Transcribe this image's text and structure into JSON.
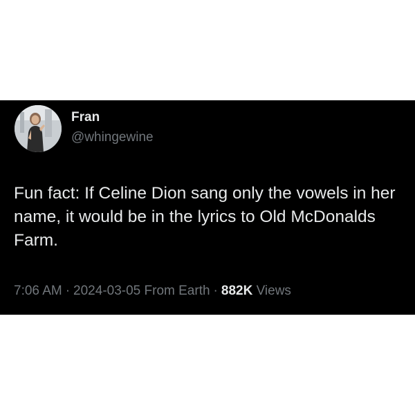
{
  "tweet": {
    "display_name": "Fran",
    "handle": "@whingewine",
    "text": "Fun fact: If Celine Dion sang only the vowels in her name, it would be in the lyrics to Old McDonalds Farm.",
    "time": "7:06 AM",
    "separator": "·",
    "date_source": "2024-03-05 From Earth",
    "views_count": "882K",
    "views_label": "Views"
  },
  "colors": {
    "background": "#000000",
    "primary_text": "#e7e9ea",
    "secondary_text": "#71767b"
  },
  "icons": {
    "avatar": "avatar-photo"
  }
}
